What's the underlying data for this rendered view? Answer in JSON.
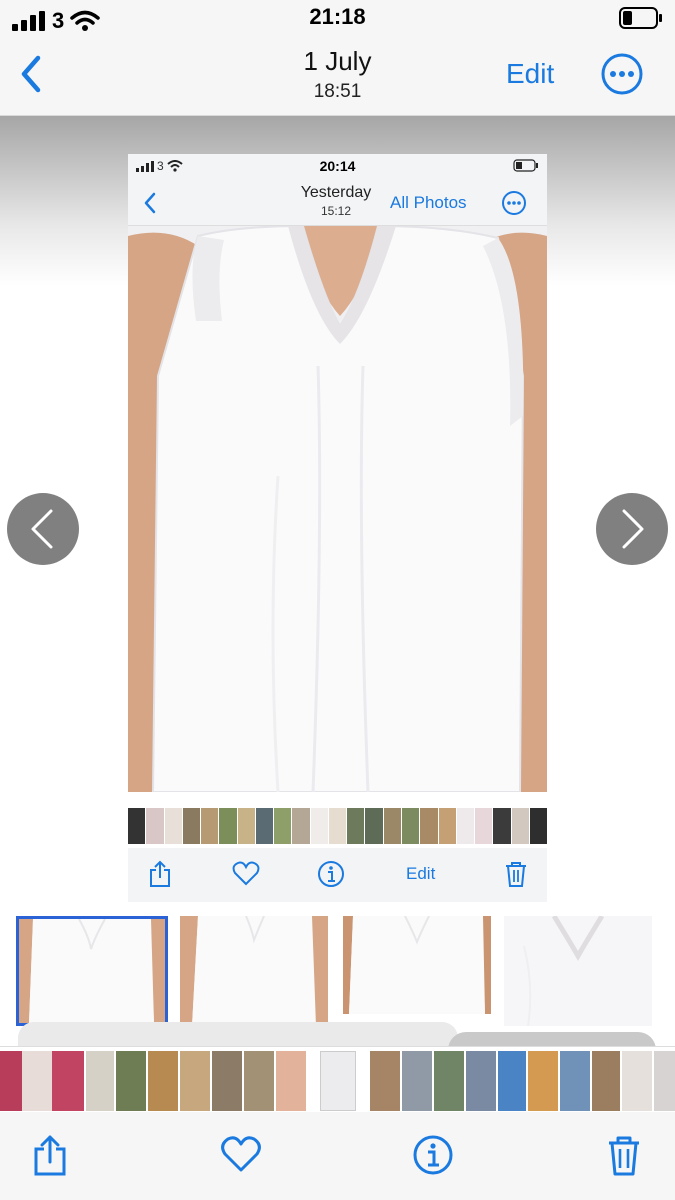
{
  "status_bar": {
    "carrier": "3",
    "time": "21:18",
    "icons": [
      "signal-icon",
      "wifi-icon",
      "battery-icon"
    ]
  },
  "nav": {
    "date": "1 July",
    "time": "18:51",
    "edit_label": "Edit",
    "icons": [
      "chevron-left-icon",
      "more-icon"
    ]
  },
  "photo": {
    "inner_screenshot": {
      "status": {
        "carrier": "3",
        "time": "20:14"
      },
      "nav": {
        "date": "Yesterday",
        "time": "15:12",
        "all_photos_label": "All Photos"
      },
      "toolbar": {
        "edit_label": "Edit",
        "icons": [
          "share-icon",
          "heart-icon",
          "info-icon",
          "trash-icon"
        ]
      }
    },
    "side_arrows": [
      "arrow-left-icon",
      "arrow-right-icon"
    ]
  },
  "toolbar": {
    "icons": [
      "share-icon",
      "heart-icon",
      "info-icon",
      "trash-icon"
    ]
  },
  "colors": {
    "accent": "#1a7ae0",
    "bar_background": "#f6f6f6",
    "selection_border": "#2b62d6"
  }
}
